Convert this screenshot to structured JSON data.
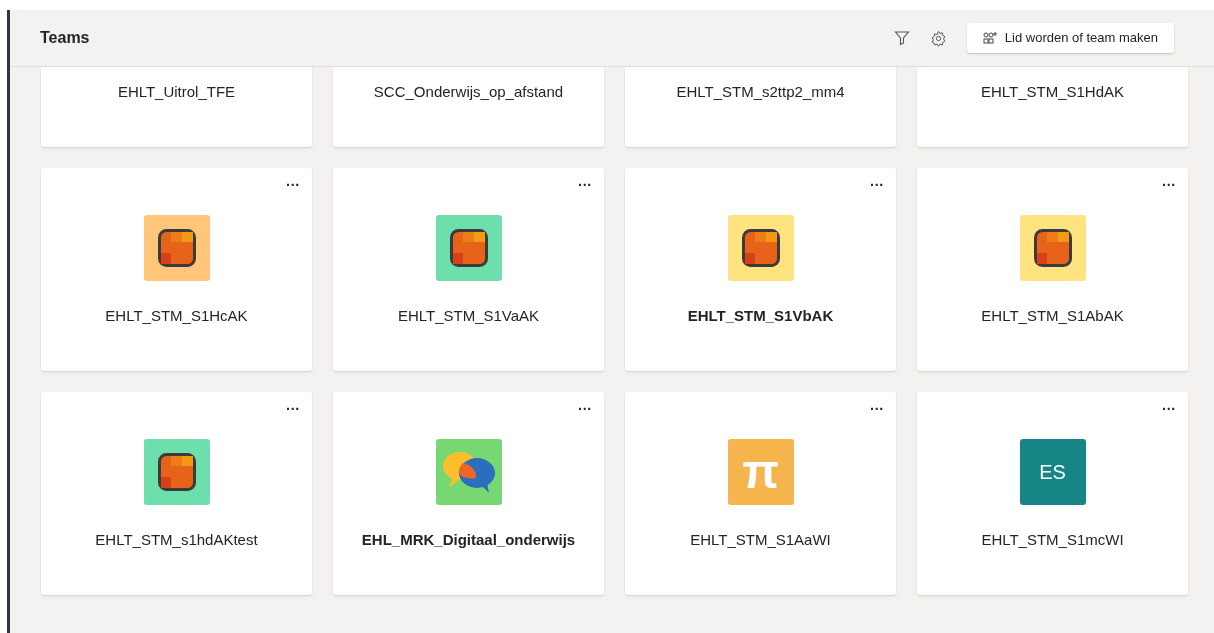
{
  "header": {
    "title": "Teams",
    "join_button": "Lid worden of team maken"
  },
  "partial_row": [
    {
      "name": "EHLT_Uitrol_TFE"
    },
    {
      "name": "SCC_Onderwijs_op_afstand"
    },
    {
      "name": "EHLT_STM_s2ttp2_mm4"
    },
    {
      "name": "EHLT_STM_S1HdAK"
    }
  ],
  "teams": [
    {
      "name": "EHLT_STM_S1HcAK",
      "unread": false,
      "more": "···",
      "icon": {
        "kind": "tile",
        "color": "#ffc67a"
      }
    },
    {
      "name": "EHLT_STM_S1VaAK",
      "unread": false,
      "more": "···",
      "icon": {
        "kind": "tile",
        "color": "#6ddfad"
      }
    },
    {
      "name": "EHLT_STM_S1VbAK",
      "unread": true,
      "more": "···",
      "icon": {
        "kind": "tile",
        "color": "#ffe381"
      }
    },
    {
      "name": "EHLT_STM_S1AbAK",
      "unread": false,
      "more": "···",
      "icon": {
        "kind": "tile",
        "color": "#ffe381"
      }
    },
    {
      "name": "EHLT_STM_s1hdAKtest",
      "unread": false,
      "more": "···",
      "icon": {
        "kind": "tile",
        "color": "#6ddfad"
      }
    },
    {
      "name": "EHL_MRK_Digitaal_onderwijs",
      "unread": true,
      "more": "···",
      "icon": {
        "kind": "chat",
        "color": "#75d873"
      }
    },
    {
      "name": "EHLT_STM_S1AaWI",
      "unread": false,
      "more": "···",
      "icon": {
        "kind": "letters",
        "color": "#f6b44c",
        "text": "π"
      }
    },
    {
      "name": "EHLT_STM_S1mcWI",
      "unread": false,
      "more": "···",
      "icon": {
        "kind": "letters",
        "color": "#158585",
        "text": "ES"
      }
    }
  ]
}
